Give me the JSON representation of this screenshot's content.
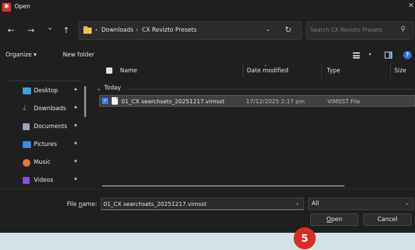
{
  "window": {
    "title": "Open"
  },
  "nav": {
    "back": "←",
    "forward": "→",
    "recent": "⌄",
    "up": "↑",
    "breadcrumb": [
      "Downloads",
      "CX Revizto Presets"
    ],
    "search_placeholder": "Search CX Revizto Presets"
  },
  "toolbar": {
    "organize_label": "Organize ▾",
    "new_folder_label": "New folder"
  },
  "sidebar": {
    "items": [
      {
        "label": "Desktop",
        "icon": "desktop-icon",
        "color": "#3aa0e8"
      },
      {
        "label": "Downloads",
        "icon": "download-icon",
        "color": "#3aa0e8"
      },
      {
        "label": "Documents",
        "icon": "documents-icon",
        "color": "#9aa6b8"
      },
      {
        "label": "Pictures",
        "icon": "pictures-icon",
        "color": "#3a8fe0"
      },
      {
        "label": "Music",
        "icon": "music-icon",
        "color": "#e8763a"
      },
      {
        "label": "Videos",
        "icon": "videos-icon",
        "color": "#8a4fe0"
      }
    ]
  },
  "columns": {
    "name": "Name",
    "date_modified": "Date modified",
    "type": "Type",
    "size": "Size"
  },
  "group": {
    "label": "Today"
  },
  "files": [
    {
      "name": "01_CX searchsets_20251217.vimsst",
      "date_modified": "17/12/2025 2:17 pm",
      "type": "VIMSST File",
      "selected": true
    }
  ],
  "footer": {
    "file_name_label_pre": "File ",
    "file_name_label_accel": "n",
    "file_name_label_post": "ame:",
    "file_name_value": "01_CX searchsets_20251217.vimsst",
    "file_type_value": "All",
    "open_accel": "O",
    "open_rest": "pen",
    "cancel_label": "Cancel"
  },
  "annotation": {
    "step_number": "5"
  },
  "colors": {
    "accent": "#3b82f6",
    "badge": "#d63024",
    "background": "#d2e3e6"
  }
}
